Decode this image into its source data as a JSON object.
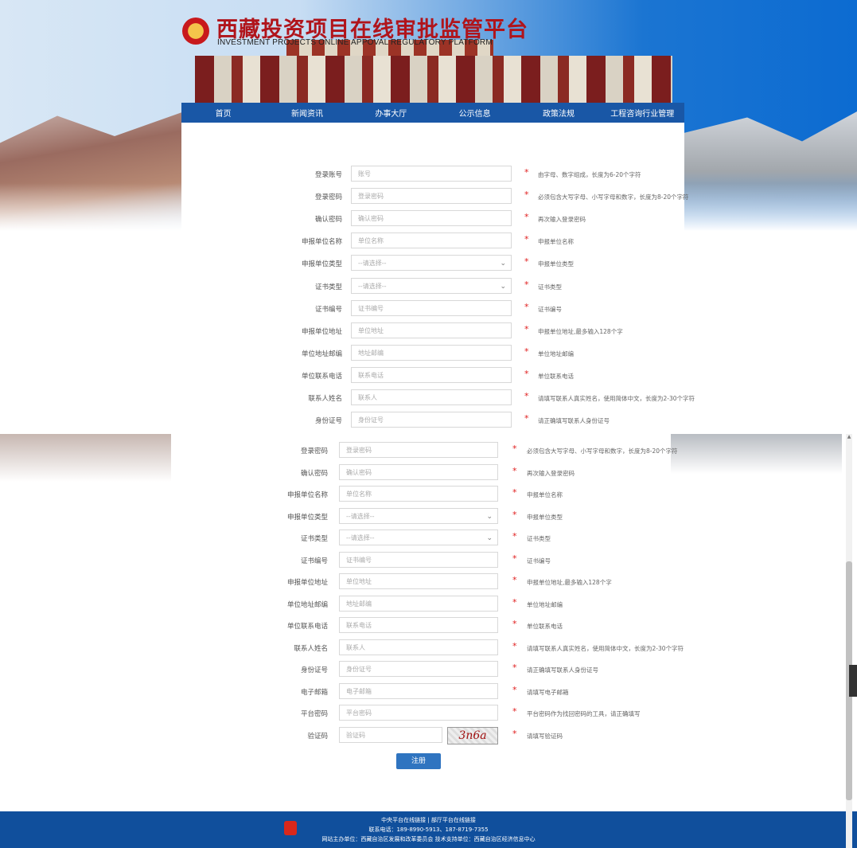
{
  "header": {
    "title_cn": "西藏投资项目在线审批监管平台",
    "title_en": "INVESTMENT PROJECTS ONLINE APPOVAL REGULATORY PLATFORM"
  },
  "nav": [
    "首页",
    "新闻资讯",
    "办事大厅",
    "公示信息",
    "政策法规",
    "工程咨询行业管理"
  ],
  "form_top": [
    {
      "label": "登录账号",
      "placeholder": "账号",
      "hint": "由字母、数字组成，长度为6-20个字符"
    },
    {
      "label": "登录密码",
      "placeholder": "登录密码",
      "hint": "必须包含大写字母、小写字母和数字，长度为8-20个字符"
    },
    {
      "label": "确认密码",
      "placeholder": "确认密码",
      "hint": "再次输入登录密码"
    },
    {
      "label": "申报单位名称",
      "placeholder": "单位名称",
      "hint": "申报单位名称"
    },
    {
      "label": "申报单位类型",
      "placeholder": "--请选择--",
      "hint": "申报单位类型",
      "select": true
    },
    {
      "label": "证书类型",
      "placeholder": "--请选择--",
      "hint": "证书类型",
      "select": true
    },
    {
      "label": "证书编号",
      "placeholder": "证书编号",
      "hint": "证书编号"
    },
    {
      "label": "申报单位地址",
      "placeholder": "单位地址",
      "hint": "申报单位地址,最多输入128个字"
    },
    {
      "label": "单位地址邮编",
      "placeholder": "地址邮编",
      "hint": "单位地址邮编"
    },
    {
      "label": "单位联系电话",
      "placeholder": "联系电话",
      "hint": "单位联系电话"
    },
    {
      "label": "联系人姓名",
      "placeholder": "联系人",
      "hint": "请填写联系人真实姓名，使用简体中文，长度为2-30个字符"
    },
    {
      "label": "身份证号",
      "placeholder": "身份证号",
      "hint": "请正确填写联系人身份证号"
    }
  ],
  "form_bottom": [
    {
      "label": "登录密码",
      "placeholder": "登录密码",
      "hint": "必须包含大写字母、小写字母和数字，长度为8-20个字符"
    },
    {
      "label": "确认密码",
      "placeholder": "确认密码",
      "hint": "再次输入登录密码"
    },
    {
      "label": "申报单位名称",
      "placeholder": "单位名称",
      "hint": "申报单位名称"
    },
    {
      "label": "申报单位类型",
      "placeholder": "--请选择--",
      "hint": "申报单位类型",
      "select": true
    },
    {
      "label": "证书类型",
      "placeholder": "--请选择--",
      "hint": "证书类型",
      "select": true
    },
    {
      "label": "证书编号",
      "placeholder": "证书编号",
      "hint": "证书编号"
    },
    {
      "label": "申报单位地址",
      "placeholder": "单位地址",
      "hint": "申报单位地址,最多输入128个字"
    },
    {
      "label": "单位地址邮编",
      "placeholder": "地址邮编",
      "hint": "单位地址邮编"
    },
    {
      "label": "单位联系电话",
      "placeholder": "联系电话",
      "hint": "单位联系电话"
    },
    {
      "label": "联系人姓名",
      "placeholder": "联系人",
      "hint": "请填写联系人真实姓名，使用简体中文，长度为2-30个字符"
    },
    {
      "label": "身份证号",
      "placeholder": "身份证号",
      "hint": "请正确填写联系人身份证号"
    },
    {
      "label": "电子邮箱",
      "placeholder": "电子邮箱",
      "hint": "请填写电子邮箱"
    },
    {
      "label": "平台密码",
      "placeholder": "平台密码",
      "hint": "平台密码作为找回密码的工具，请正确填写"
    },
    {
      "label": "验证码",
      "placeholder": "验证码",
      "hint": "请填写验证码",
      "captcha": "3n6a"
    }
  ],
  "required_mark": "*",
  "submit_label": "注册",
  "footer": {
    "line1": "中央平台在线链接 | 部厅平台在线链接",
    "line2": "联系电话：189-8990-5913、187-8719-7355",
    "line3": "网站主办单位：西藏自治区发展和改革委员会 技术支持单位：西藏自治区经济信息中心"
  }
}
